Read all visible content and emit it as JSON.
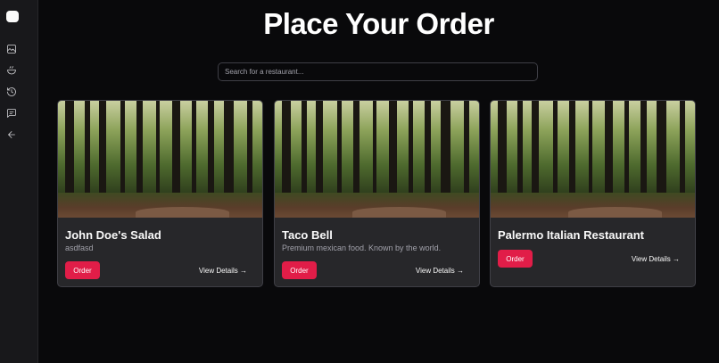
{
  "sidebar": {
    "icons": [
      "image-icon",
      "bowl-icon",
      "history-icon",
      "message-icon",
      "arrow-left-icon"
    ]
  },
  "page": {
    "title": "Place Your Order"
  },
  "search": {
    "placeholder": "Search for a restaurant..."
  },
  "restaurants": [
    {
      "name": "John Doe's Salad",
      "description": "asdfasd",
      "order_label": "Order",
      "details_label": "View Details →"
    },
    {
      "name": "Taco Bell",
      "description": "Premium mexican food. Known by the world.",
      "order_label": "Order",
      "details_label": "View Details →"
    },
    {
      "name": "Palermo Italian Restaurant",
      "description": "",
      "order_label": "Order",
      "details_label": "View Details →"
    }
  ],
  "colors": {
    "accent": "#e11d48",
    "background": "#09090b",
    "card": "#27272a"
  }
}
